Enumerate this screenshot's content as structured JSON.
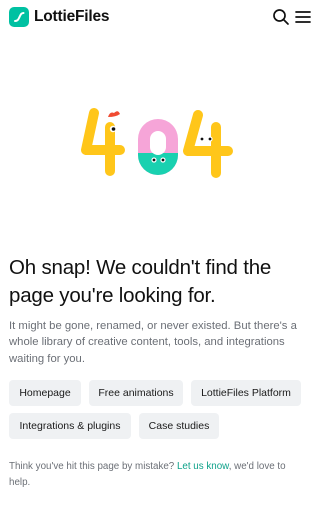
{
  "header": {
    "brand": "LottieFiles",
    "icons": {
      "logo": "lottiefiles-logo-icon",
      "search": "search-icon",
      "menu": "hamburger-menu-icon"
    },
    "brand_color": "#00c1a2"
  },
  "illustration": {
    "digits": [
      "4",
      "0",
      "4"
    ],
    "colors": {
      "yellow": "#ffc61a",
      "pink": "#f6a5d8",
      "teal": "#19d1b0",
      "red": "#f04b32"
    }
  },
  "main": {
    "title": "Oh snap! We couldn't find the page you're looking for.",
    "description": "It might be gone, renamed, or never existed. But there's a whole library of creative content, tools, and integrations waiting for you.",
    "links": [
      {
        "label": "Homepage"
      },
      {
        "label": "Free animations"
      },
      {
        "label": "LottieFiles Platform"
      },
      {
        "label": "Integrations & plugins"
      },
      {
        "label": "Case studies"
      }
    ],
    "footer_prefix": "Think you've hit this page by mistake? ",
    "footer_link": "Let us know",
    "footer_suffix": ", we'd love to help.",
    "link_color": "#0fa28a"
  }
}
